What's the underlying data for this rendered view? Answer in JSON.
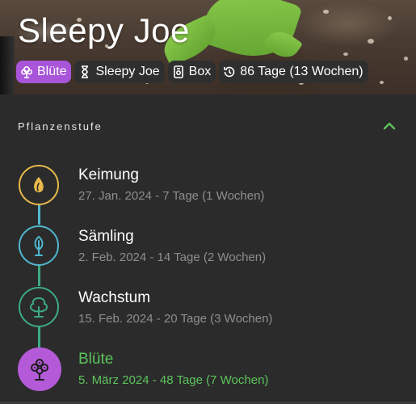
{
  "header": {
    "title": "Sleepy Joe",
    "chips": [
      {
        "label": "Blüte",
        "icon": "flower-icon",
        "active": true
      },
      {
        "label": "Sleepy Joe",
        "icon": "hourglass-icon",
        "active": false
      },
      {
        "label": "Box",
        "icon": "box-icon",
        "active": false
      },
      {
        "label": "86 Tage (13 Wochen)",
        "icon": "history-icon",
        "active": false
      }
    ]
  },
  "section": {
    "title": "Pflanzenstufe",
    "collapse_icon": "chevron-up-icon"
  },
  "stages": [
    {
      "name": "Keimung",
      "detail": "27. Jan. 2024 - 7 Tage (1 Wochen)",
      "icon": "seed-icon",
      "color": "#e7b94a"
    },
    {
      "name": "Sämling",
      "detail": "2. Feb. 2024 - 14 Tage (2 Wochen)",
      "icon": "seedling-leaf-icon",
      "color": "#4fb8cf"
    },
    {
      "name": "Wachstum",
      "detail": "15. Feb. 2024 - 20 Tage (3 Wochen)",
      "icon": "tree-icon",
      "color": "#3daa82"
    },
    {
      "name": "Blüte",
      "detail": "5. März 2024 - 48 Tage (7 Wochen)",
      "icon": "flower-tree-icon",
      "color": "#b45ad8",
      "current": true
    }
  ],
  "colors": {
    "accent_purple": "#a855d9",
    "accent_green": "#5cc45c",
    "background": "#2b2b2b"
  }
}
